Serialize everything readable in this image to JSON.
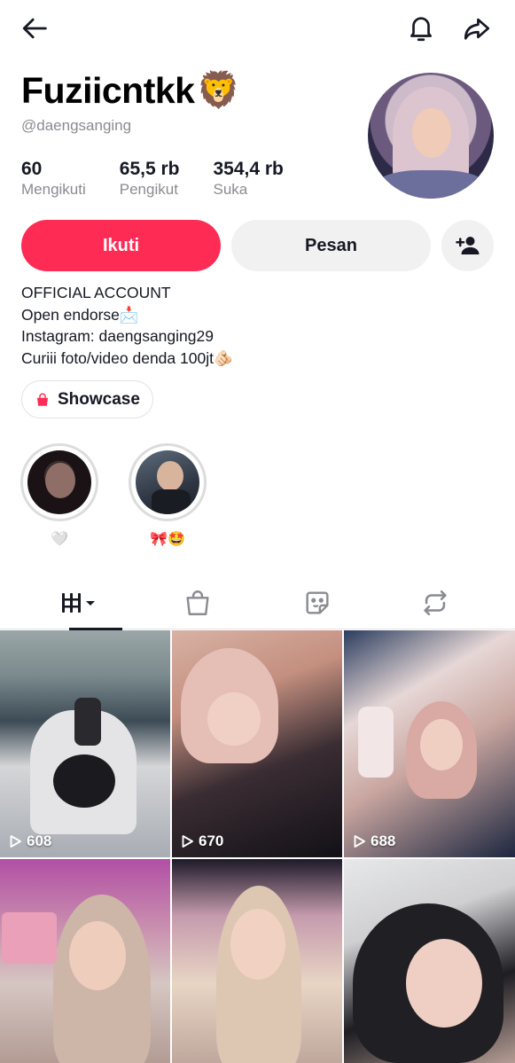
{
  "profile": {
    "display_name": "Fuziicntkk",
    "name_emoji": "🦁",
    "username": "@daengsanging",
    "stats": [
      {
        "value": "60",
        "label": "Mengikuti"
      },
      {
        "value": "65,5 rb",
        "label": "Pengikut"
      },
      {
        "value": "354,4 rb",
        "label": "Suka"
      }
    ]
  },
  "actions": {
    "follow_label": "Ikuti",
    "message_label": "Pesan"
  },
  "bio": {
    "lines": [
      "OFFICIAL ACCOUNT",
      "Open endorse📩",
      "Instagram: daengsanging29",
      "Curiii foto/video denda 100jt🫵🏻"
    ]
  },
  "showcase": {
    "label": "Showcase"
  },
  "highlights": [
    {
      "caption": "🤍"
    },
    {
      "caption": "🎀🤩"
    }
  ],
  "tabs": [
    {
      "icon": "grid-icon"
    },
    {
      "icon": "shopping-bag-icon"
    },
    {
      "icon": "sticker-icon"
    },
    {
      "icon": "repost-icon"
    }
  ],
  "videos": [
    {
      "views": "608"
    },
    {
      "views": "670"
    },
    {
      "views": "688"
    },
    {
      "views": ""
    },
    {
      "views": ""
    },
    {
      "views": ""
    }
  ],
  "colors": {
    "accent": "#fe2c55",
    "secondary_button": "#f1f1f2",
    "muted_text": "#8a8b91"
  }
}
